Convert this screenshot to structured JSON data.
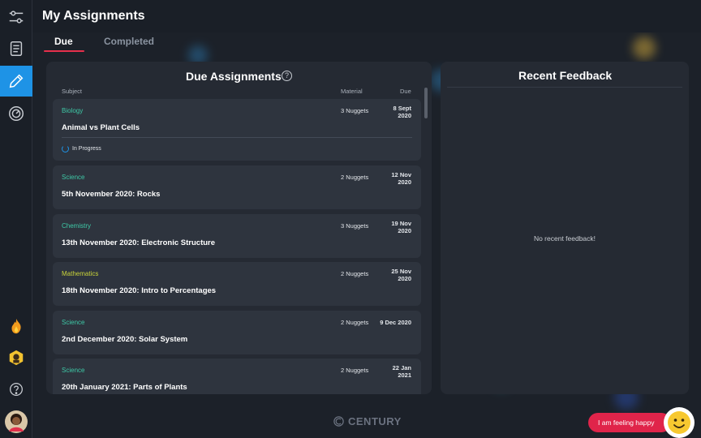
{
  "header": {
    "title": "My Assignments"
  },
  "tabs": [
    {
      "label": "Due",
      "active": true
    },
    {
      "label": "Completed",
      "active": false
    }
  ],
  "due_panel": {
    "title": "Due Assignments",
    "columns": {
      "subject": "Subject",
      "material": "Material",
      "due": "Due"
    },
    "assignments": [
      {
        "subject": "Biology",
        "subject_color": "#3ec9a7",
        "title": "Animal vs Plant Cells",
        "material": "3 Nuggets",
        "due_line1": "8 Sept",
        "due_line2": "2020",
        "status": "In Progress"
      },
      {
        "subject": "Science",
        "subject_color": "#3ec9a7",
        "title": "5th November 2020: Rocks",
        "material": "2 Nuggets",
        "due_line1": "12 Nov",
        "due_line2": "2020"
      },
      {
        "subject": "Chemistry",
        "subject_color": "#3ec9a7",
        "title": "13th November 2020: Electronic Structure",
        "material": "3 Nuggets",
        "due_line1": "19 Nov",
        "due_line2": "2020"
      },
      {
        "subject": "Mathematics",
        "subject_color": "#c9d33a",
        "title": "18th November 2020: Intro to Percentages",
        "material": "2 Nuggets",
        "due_line1": "25 Nov",
        "due_line2": "2020"
      },
      {
        "subject": "Science",
        "subject_color": "#3ec9a7",
        "title": "2nd December 2020: Solar System",
        "material": "2 Nuggets",
        "due_line1": "9 Dec 2020",
        "due_line2": ""
      },
      {
        "subject": "Science",
        "subject_color": "#3ec9a7",
        "title": "20th January 2021: Parts of Plants",
        "material": "2 Nuggets",
        "due_line1": "22 Jan",
        "due_line2": "2021"
      }
    ]
  },
  "feedback_panel": {
    "title": "Recent Feedback",
    "empty_text": "No recent feedback!"
  },
  "footer": {
    "logo_text": "CENTURY",
    "mood_button": "I am feeling happy"
  },
  "sidebar": {
    "items": [
      {
        "icon": "sliders-icon"
      },
      {
        "icon": "notebook-icon"
      },
      {
        "icon": "pencil-icon",
        "active": true
      },
      {
        "icon": "gauge-icon"
      },
      {
        "icon": "flame-icon"
      },
      {
        "icon": "badge-icon"
      },
      {
        "icon": "help-icon"
      },
      {
        "icon": "avatar"
      }
    ]
  },
  "help_glyph": "?",
  "colors": {
    "accent": "#1e93e6",
    "tab_underline": "#e6304c",
    "mood_button": "#e0244a"
  }
}
